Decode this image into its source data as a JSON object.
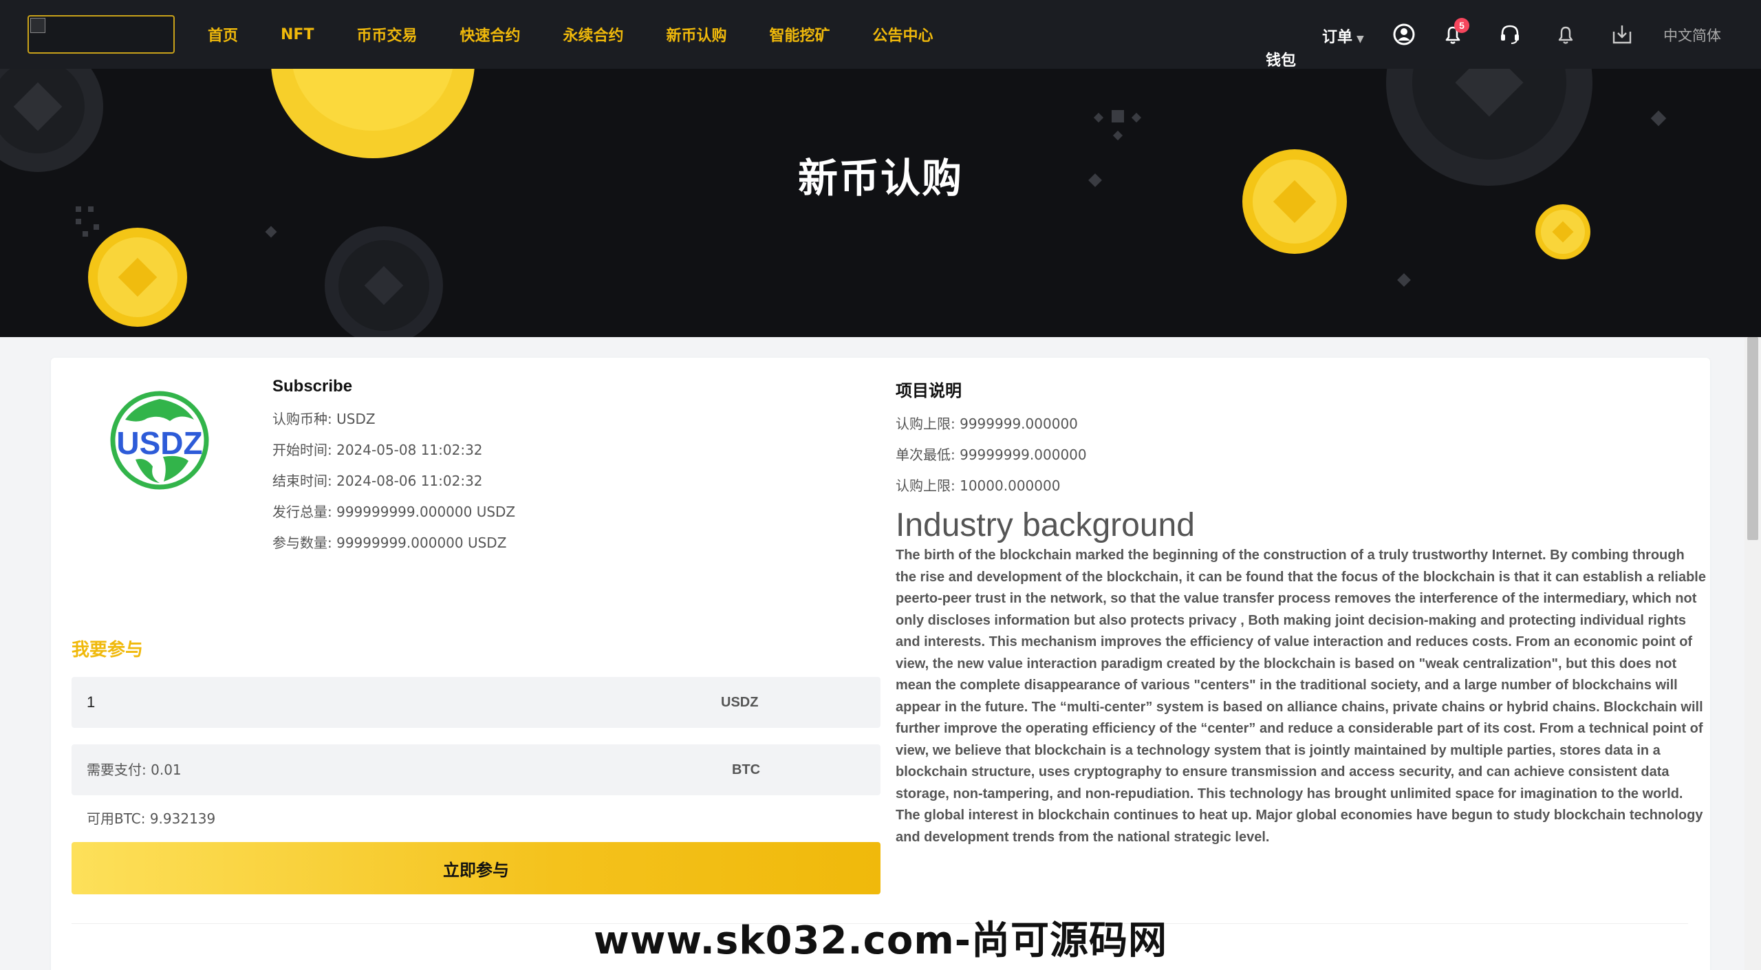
{
  "nav": {
    "links": [
      "首页",
      "NFT",
      "币币交易",
      "快速合约",
      "永续合约",
      "新币认购",
      "智能挖矿",
      "公告中心"
    ],
    "wallet": "钱包",
    "orders": "订单",
    "notification_count": "5",
    "language": "中文简体",
    "icons": [
      "user-icon",
      "bell-icon",
      "headset-icon",
      "bell-outline-icon",
      "download-icon"
    ]
  },
  "hero": {
    "title": "新币认购"
  },
  "coin": {
    "logo_text": "USDZ"
  },
  "subscribe": {
    "title": "Subscribe",
    "rows": [
      {
        "label": "认购币种:",
        "value": "USDZ"
      },
      {
        "label": "开始时间:",
        "value": "2024-05-08 11:02:32"
      },
      {
        "label": "结束时间:",
        "value": "2024-08-06 11:02:32"
      },
      {
        "label": "发行总量:",
        "value": "999999999.000000 USDZ"
      },
      {
        "label": "参与数量:",
        "value": "99999999.000000 USDZ"
      }
    ]
  },
  "join": {
    "title": "我要参与",
    "amount_value": "1",
    "amount_unit": "USDZ",
    "pay_label": "需要支付:",
    "pay_value": "0.01",
    "pay_unit": "BTC",
    "available_label": "可用BTC:",
    "available_value": "9.932139",
    "submit_label": "立即参与"
  },
  "project": {
    "title": "项目说明",
    "rows": [
      {
        "label": "认购上限:",
        "value": "9999999.000000"
      },
      {
        "label": "单次最低:",
        "value": "99999999.000000"
      },
      {
        "label": "认购上限:",
        "value": "10000.000000"
      }
    ],
    "industry_title": "Industry background",
    "industry_body": "The birth of the blockchain marked the beginning of the construction of a truly trustworthy Internet. By combing through the rise and development of the blockchain, it can be found that the focus of the blockchain is that it can establish a reliable peerto-peer trust in the network, so that the value transfer process removes the interference of the intermediary, which not only discloses information but also protects privacy , Both making joint decision-making and protecting individual rights and interests. This mechanism improves the efficiency of value interaction and reduces costs. From an economic point of view, the new value interaction paradigm created by the blockchain is based on \"weak centralization\", but this does not mean the complete disappearance of various \"centers\" in the traditional society, and a large number of blockchains will appear in the future. The “multi-center” system is based on alliance chains, private chains or hybrid chains. Blockchain will further improve the operating efficiency of the “center” and reduce a considerable part of its cost. From a technical point of view, we believe that blockchain is a technology system that is jointly maintained by multiple parties, stores data in a blockchain structure, uses cryptography to ensure transmission and access security, and can achieve consistent data storage, non-tampering, and non-repudiation. This technology has brought unlimited space for imagination to the world. The global interest in blockchain continues to heat up. Major global economies have begun to study blockchain technology and development trends from the national strategic level."
  },
  "watermark": "www.sk032.com-尚可源码网",
  "colors": {
    "accent": "#f0b90b",
    "nav_bg": "#1b1d22",
    "hero_bg": "#101114",
    "badge": "#f6465d"
  }
}
